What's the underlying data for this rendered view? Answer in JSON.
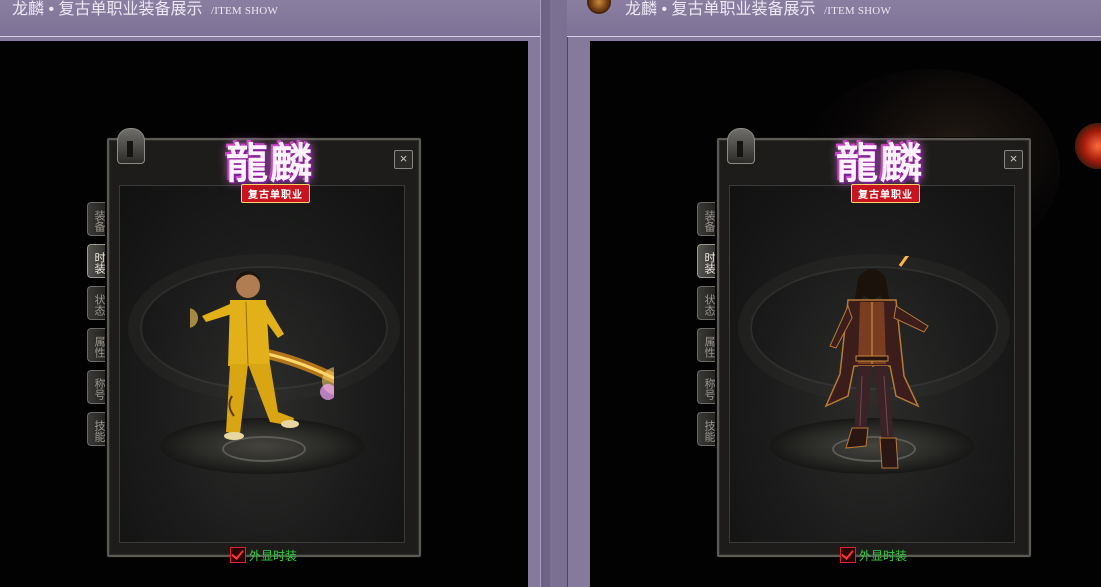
{
  "header": {
    "title": "龙麟 • 复古单职业装备展示",
    "subtitle": "/ITEM SHOW"
  },
  "game_logo": {
    "text": "龍麟",
    "tag": "复古单职业"
  },
  "panels": [
    {
      "tabs": [
        "装备",
        "时装",
        "状态",
        "属性",
        "称号",
        "技能"
      ],
      "active_tab": "时装",
      "close_label": "×",
      "toggle_label": "外显时装",
      "toggle_checked": true,
      "character": "yellow-jumpsuit-fighter"
    },
    {
      "tabs": [
        "装备",
        "时装",
        "状态",
        "属性",
        "称号",
        "技能"
      ],
      "active_tab": "时装",
      "close_label": "×",
      "toggle_label": "外显时装",
      "toggle_checked": true,
      "character": "pirate-captain-trident"
    }
  ],
  "colors": {
    "page_bg": "#857a9b",
    "stage_bg": "#030203",
    "toggle_text": "#31d141",
    "checkbox_mark": "#ff3232"
  }
}
